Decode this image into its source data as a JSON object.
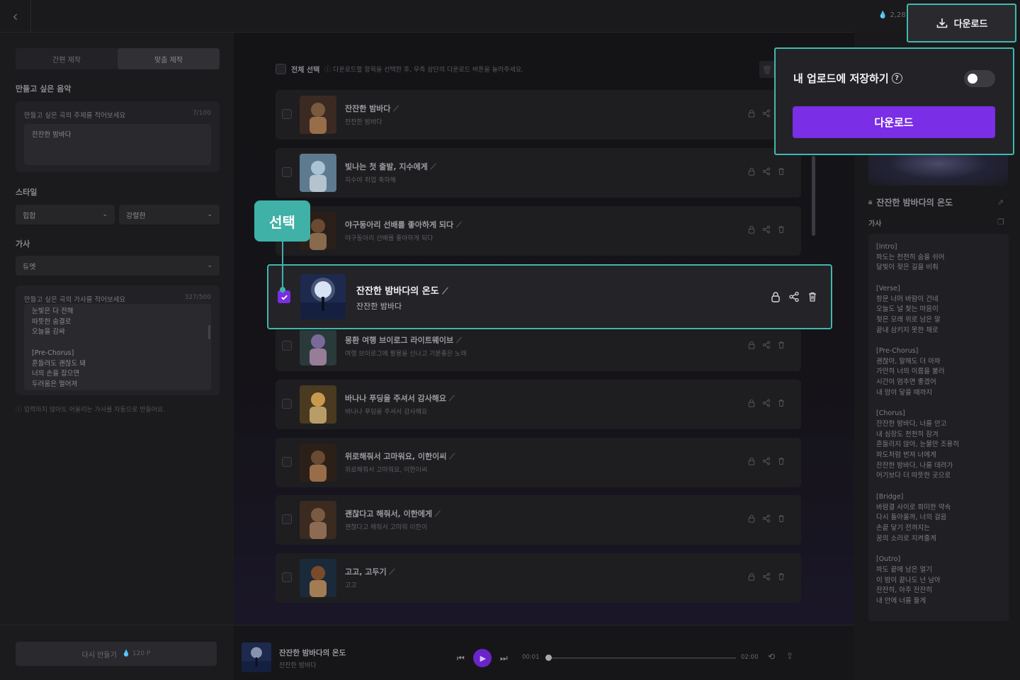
{
  "left": {
    "tabs": [
      "간편 제작",
      "맞춤 제작"
    ],
    "music_label": "만들고 싶은 음악",
    "theme_box": {
      "label": "만들고 싶은 곡의 주제를 적어보세요",
      "count": "7/100",
      "value": "잔잔한 밤바다"
    },
    "style_label": "스타일",
    "style_select_1": "힙합",
    "style_select_2": "강렬한",
    "lyrics_label": "가사",
    "lyrics_select": "듀엣",
    "lyrics_box": {
      "label": "만들고 싶은 곡의 가사를 적어보세요",
      "count": "327/500",
      "value": "눈빛은 다 전해\n따뜻한 숨결로\n오늘을 감싸\n\n[Pre-Chorus]\n흔들려도 괜찮도 돼\n너의 손을 잡으면\n두려움은 멀어져"
    },
    "hint": "입력하지 않아도 어울리는 가사를 자동으로 만들어요.",
    "regen_label": "다시 만들기",
    "regen_cost": "120 P"
  },
  "center": {
    "select_all": "전체 선택",
    "select_hint": "다운로드할 항목을 선택한 후, 우측 상단의 다운로드 버튼을 눌러주세요.",
    "songs": [
      {
        "title": "잔잔한 밤바다",
        "sub": "잔잔한 밤바다"
      },
      {
        "title": "빛나는 첫 출발, 지수에게",
        "sub": "지수야 취업 축하해"
      },
      {
        "title": "야구동아리 선배를 좋아하게 되다",
        "sub": "야구동아리 선배를 좋아하게 되다"
      },
      {
        "title": "잔잔한 밤바다의 온도",
        "sub": "잔잔한 밤바다"
      },
      {
        "title": "몽환 여행 브이로그 라이트웨이브",
        "sub": "여행 브이로그에 활용을 신나고 기분좋은 노래"
      },
      {
        "title": "바나나 푸딩을 주셔서 감사해요",
        "sub": "바나나 푸딩을 주셔서 감사해요"
      },
      {
        "title": "위로해줘서 고마워요, 이한이씨",
        "sub": "위로해줘서 고마워요, 이한이씨"
      },
      {
        "title": "괜찮다고 해줘서, 이한에게",
        "sub": "괜찮다고 해줘서 고마워 이한이"
      },
      {
        "title": "고고, 고두기",
        "sub": "고고"
      }
    ],
    "callout": "선택"
  },
  "player": {
    "title": "잔잔한 밤바다의 온도",
    "sub": "잔잔한 밤바다",
    "current": "00:01",
    "total": "02:00",
    "progress": 0.01
  },
  "right": {
    "coins": "2,28",
    "download_label": "다운로드",
    "song_title": "잔잔한 밤바다의 온도",
    "lyrics_label": "가사",
    "lyrics": "[Intro]\n파도는 천천히 숨을 쉬어\n달빛이 젖은 길을 비춰\n\n[Verse]\n창문 너머 바람이 건네\n오늘도 널 찾는 마음이\n젖은 모래 위로 남은 말\n끝내 삼키지 못한 채로\n\n[Pre-Chorus]\n괜찮아, 말해도 더 아파\n가만히 너의 이름을 불러\n시간이 멈추면 좋겠어\n내 맘이 닿을 때까지\n\n[Chorus]\n잔잔한 밤바다, 너를 안고\n내 심장도 천천히 잠겨\n흔들리지 않아, 눈물만 조용히\n파도처럼 번져 너에게\n잔잔한 밤바다, 나를 데려가\n어기보다 더 따뜻한 곳으로\n\n[Bridge]\n바람결 사이로 희미한 약속\n다시 돌아올까, 너의 걸음\n손끝 닿기 전까지는\n꿈의 소리로 지켜줄게\n\n[Outro]\n파도 끝에 남은 얼기\n이 밤이 끝나도 넌 남아\n잔잔히, 아주 잔잔히\n내 안에 너를 둘게"
  },
  "popup": {
    "save_label": "내 업로드에 저장하기",
    "save_enabled": false,
    "button": "다운로드"
  },
  "colors": {
    "accent": "#7a2ee6",
    "highlight": "#3fb8b0"
  }
}
